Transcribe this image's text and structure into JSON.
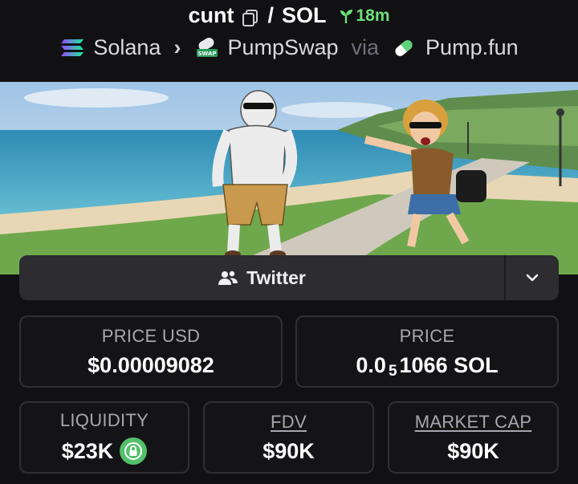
{
  "header": {
    "token_symbol": "cunt",
    "separator": "/",
    "quote_symbol": "SOL",
    "age": "18m",
    "chain": "Solana",
    "dex": "PumpSwap",
    "via": "via",
    "launchpad": "Pump.fun"
  },
  "social": {
    "twitter_label": "Twitter"
  },
  "stats": {
    "price_usd_label": "PRICE USD",
    "price_usd_value": "$0.00009082",
    "price_label": "PRICE",
    "price_value_prefix": "0.0",
    "price_value_zeros": "5",
    "price_value_suffix": "1066 SOL",
    "liquidity_label": "LIQUIDITY",
    "liquidity_value": "$23K",
    "fdv_label": "FDV",
    "fdv_value": "$90K",
    "mcap_label": "MARKET CAP",
    "mcap_value": "$90K"
  },
  "colors": {
    "background": "#111114",
    "card_border": "#2f2f35",
    "age_green": "#6fe07a",
    "lock_green": "#53c06a"
  }
}
